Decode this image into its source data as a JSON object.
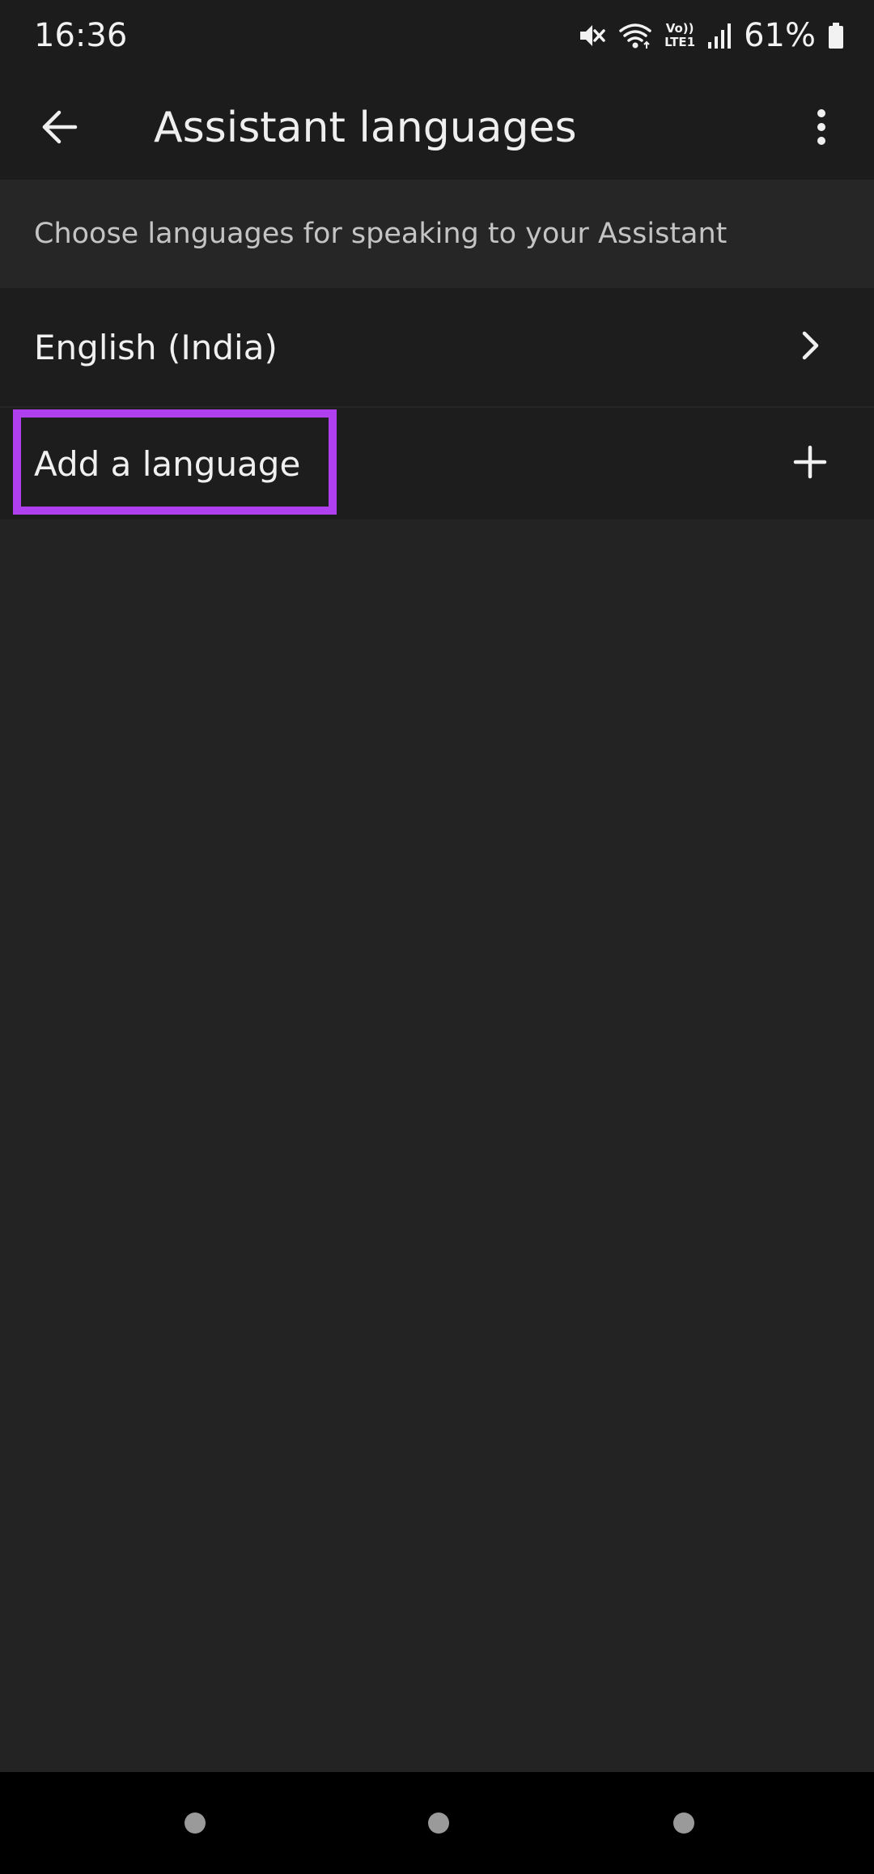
{
  "status_bar": {
    "time": "16:36",
    "network_badge_top": "Vo))",
    "network_badge_bottom": "LTE1",
    "battery_percent": "61%",
    "icons": [
      "mute-icon",
      "wifi-icon",
      "lte-icon",
      "signal-icon",
      "battery-icon"
    ]
  },
  "toolbar": {
    "title": "Assistant languages",
    "back_icon": "arrow-left-icon",
    "more_icon": "more-vertical-icon"
  },
  "description": {
    "text": "Choose languages for speaking to your Assistant"
  },
  "languages": [
    {
      "label": "English (India)",
      "icon": "chevron-right-icon"
    }
  ],
  "add_language": {
    "label": "Add a language",
    "icon": "plus-icon"
  },
  "colors": {
    "background": "#232323",
    "toolbar": "#1c1c1c",
    "highlight": "#b03ff0",
    "nav_bar": "#000000"
  },
  "nav_bar": {
    "buttons": [
      "recent-apps-button",
      "home-button",
      "back-nav-button"
    ]
  }
}
